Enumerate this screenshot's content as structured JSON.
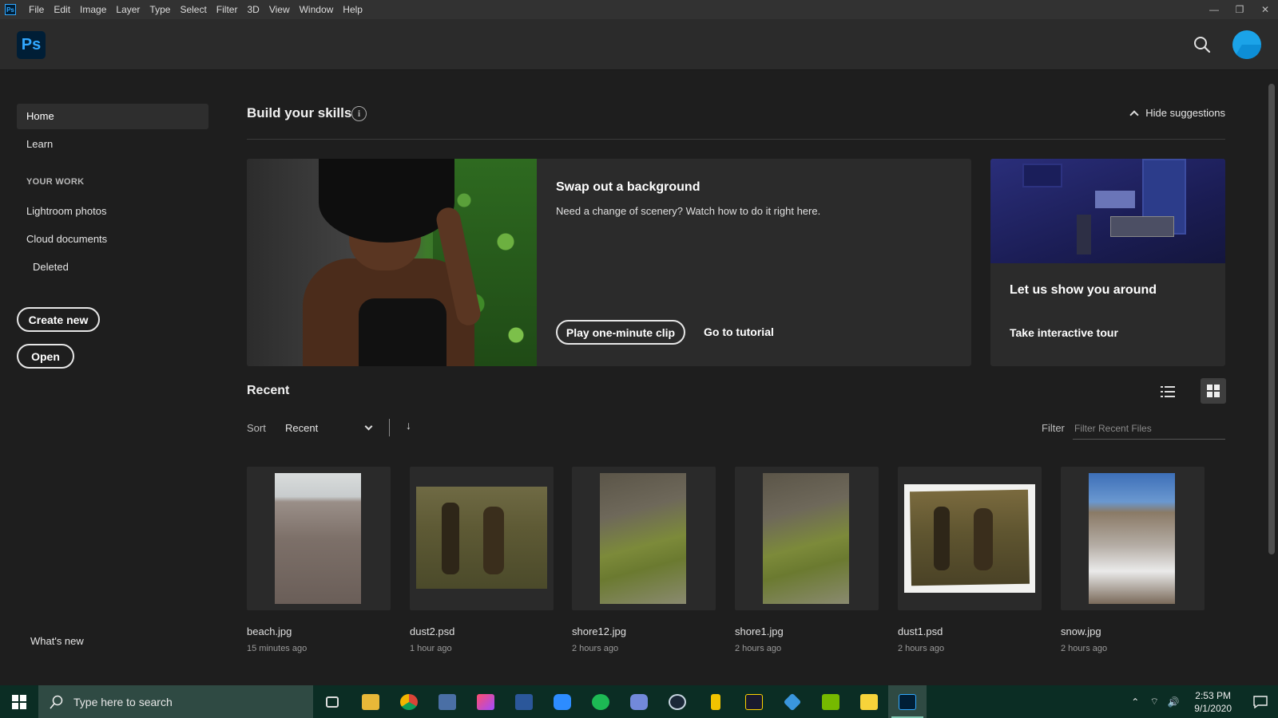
{
  "menubar": {
    "app_badge": "Ps",
    "items": [
      "File",
      "Edit",
      "Image",
      "Layer",
      "Type",
      "Select",
      "Filter",
      "3D",
      "View",
      "Window",
      "Help"
    ],
    "minimize": "—",
    "restore": "❐",
    "close": "✕"
  },
  "header": {
    "logo": "Ps"
  },
  "sidebar": {
    "home": "Home",
    "learn": "Learn",
    "your_work_label": "YOUR WORK",
    "lightroom": "Lightroom photos",
    "cloud_docs": "Cloud documents",
    "deleted": "Deleted",
    "create_new": "Create new",
    "open": "Open",
    "whats_new": "What's new"
  },
  "skills": {
    "title": "Build your skills",
    "info_glyph": "i",
    "hide_suggestions": "Hide suggestions",
    "swap": {
      "title": "Swap out a background",
      "description": "Need a change of scenery? Watch how to do it right here.",
      "play_label": "Play one-minute clip",
      "tutorial_label": "Go to tutorial"
    },
    "tour": {
      "title": "Let us show you around",
      "link": "Take interactive tour"
    }
  },
  "recent": {
    "title": "Recent",
    "sort_label": "Sort",
    "sort_value": "Recent",
    "sort_direction_glyph": "↓",
    "filter_label": "Filter",
    "filter_placeholder": "Filter Recent Files",
    "files": [
      {
        "name": "beach.jpg",
        "time": "15 minutes ago"
      },
      {
        "name": "dust2.psd",
        "time": "1 hour ago"
      },
      {
        "name": "shore12.jpg",
        "time": "2 hours ago"
      },
      {
        "name": "shore1.jpg",
        "time": "2 hours ago"
      },
      {
        "name": "dust1.psd",
        "time": "2 hours ago"
      },
      {
        "name": "snow.jpg",
        "time": "2 hours ago"
      }
    ]
  },
  "taskbar": {
    "search_placeholder": "Type here to search",
    "time": "2:53 PM",
    "date": "9/1/2020",
    "apps": [
      "task-view",
      "file-explorer",
      "chrome",
      "calculator",
      "creative-cloud",
      "word",
      "zoom",
      "spotify",
      "discord",
      "steam",
      "app-3",
      "app-a",
      "visual-studio",
      "nvidia",
      "sticky-notes",
      "photoshop"
    ]
  },
  "colors": {
    "accent": "#31a8ff",
    "background": "#1e1e1e",
    "card": "#2b2b2b",
    "taskbar": "#0b2d24"
  }
}
